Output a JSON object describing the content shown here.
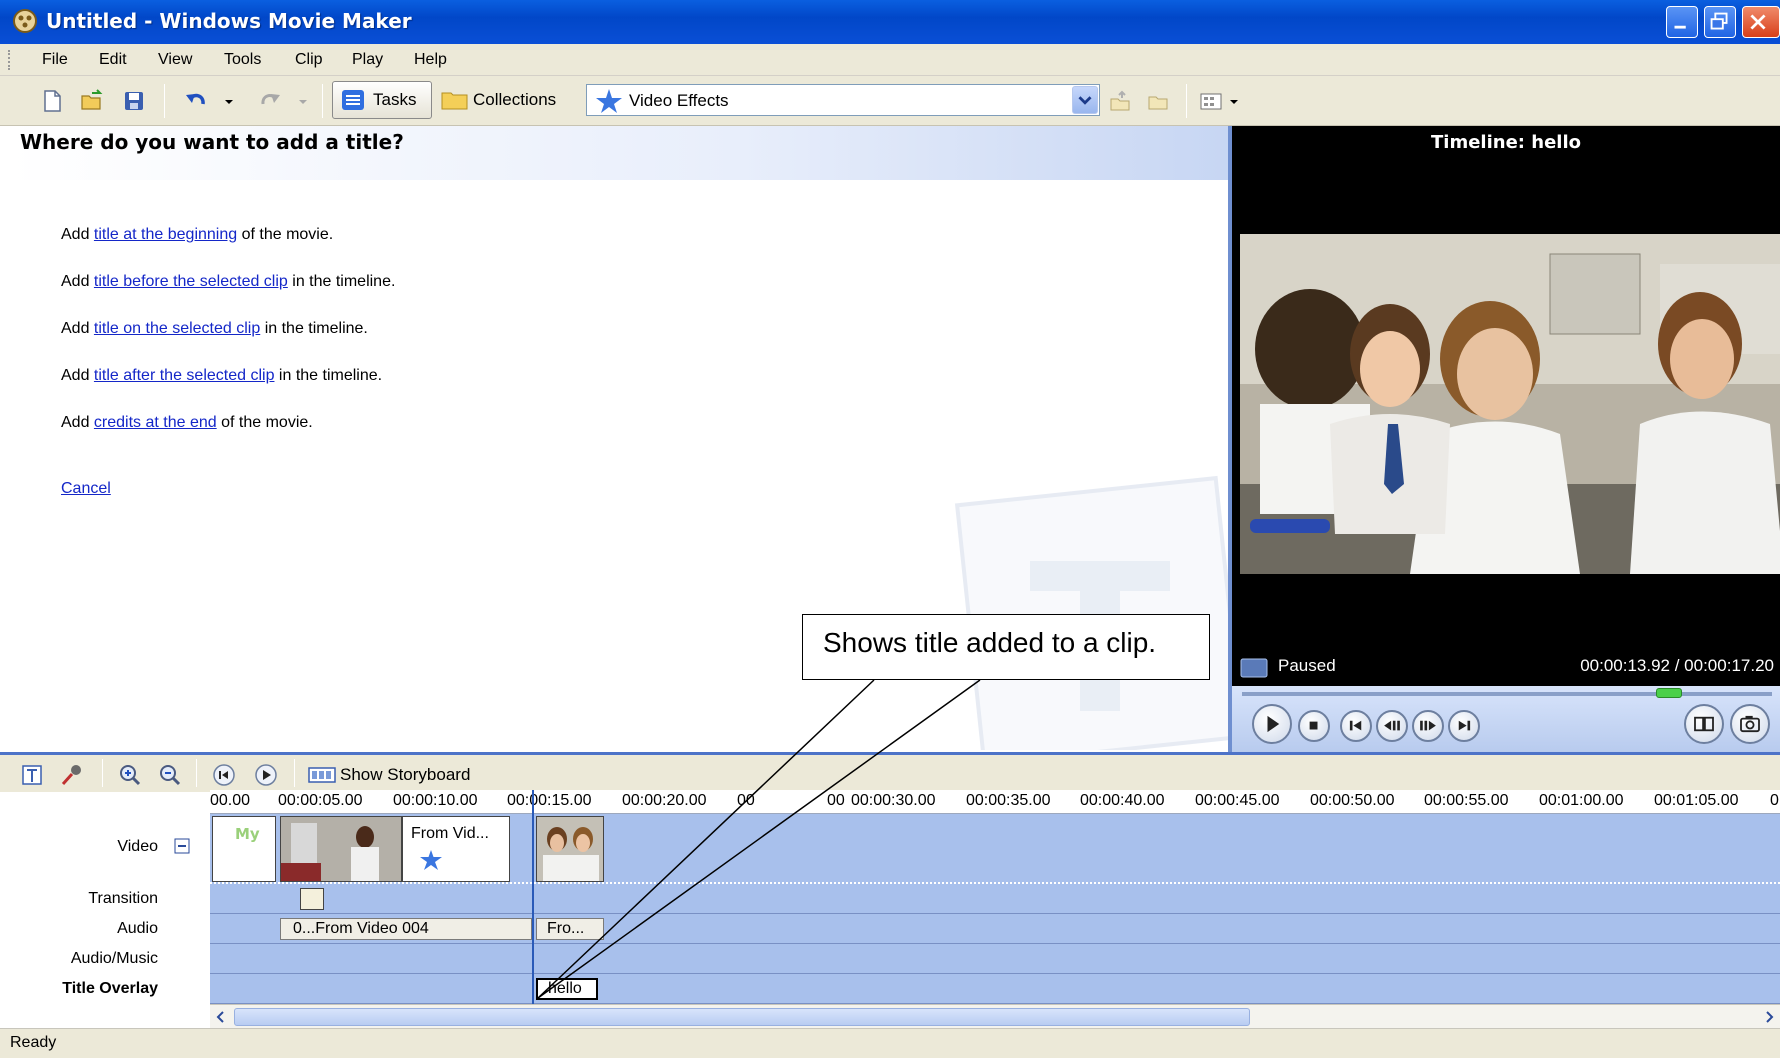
{
  "window": {
    "title": "Untitled - Windows Movie Maker"
  },
  "menu": [
    "File",
    "Edit",
    "View",
    "Tools",
    "Clip",
    "Play",
    "Help"
  ],
  "toolbar": {
    "tasks_label": "Tasks",
    "collections_label": "Collections",
    "collection_select": "Video Effects"
  },
  "task_pane": {
    "heading": "Where do you want to add a title?",
    "options": [
      {
        "prefix": "Add ",
        "link": "title at the beginning",
        "suffix": " of the movie."
      },
      {
        "prefix": "Add ",
        "link": "title before the selected clip",
        "suffix": " in the timeline."
      },
      {
        "prefix": "Add ",
        "link": "title on the selected clip",
        "suffix": " in the timeline."
      },
      {
        "prefix": "Add ",
        "link": "title after the selected clip",
        "suffix": " in the timeline."
      },
      {
        "prefix": "Add ",
        "link": "credits at the end",
        "suffix": " of the movie."
      }
    ],
    "cancel": "Cancel"
  },
  "preview": {
    "title": "Timeline: hello",
    "state": "Paused",
    "time": "00:00:13.92 / 00:00:17.20"
  },
  "timeline": {
    "storyboard_label": "Show Storyboard",
    "ruler": [
      "00.00",
      "00:00:05.00",
      "00:00:10.00",
      "00:00:15.00",
      "00:00:20.00",
      "00",
      "00",
      "00:00:30.00",
      "00:00:35.00",
      "00:00:40.00",
      "00:00:45.00",
      "00:00:50.00",
      "00:00:55.00",
      "00:01:00.00",
      "00:01:05.00",
      "0"
    ],
    "tracks": {
      "video": "Video",
      "transition": "Transition",
      "audio": "Audio",
      "audio_music": "Audio/Music",
      "title_overlay": "Title Overlay"
    },
    "clips": {
      "video_title_card": "My",
      "video_from": "From Vid...",
      "audio_main": "0...From Video 004",
      "audio_second": "Fro...",
      "overlay": "hello"
    }
  },
  "callout": "Shows title added to a clip.",
  "status": "Ready",
  "colors": {
    "titlebar": "#0147c8",
    "link": "#1427c8",
    "tracks": "#a8c0ec",
    "chrome": "#ece9d8"
  }
}
